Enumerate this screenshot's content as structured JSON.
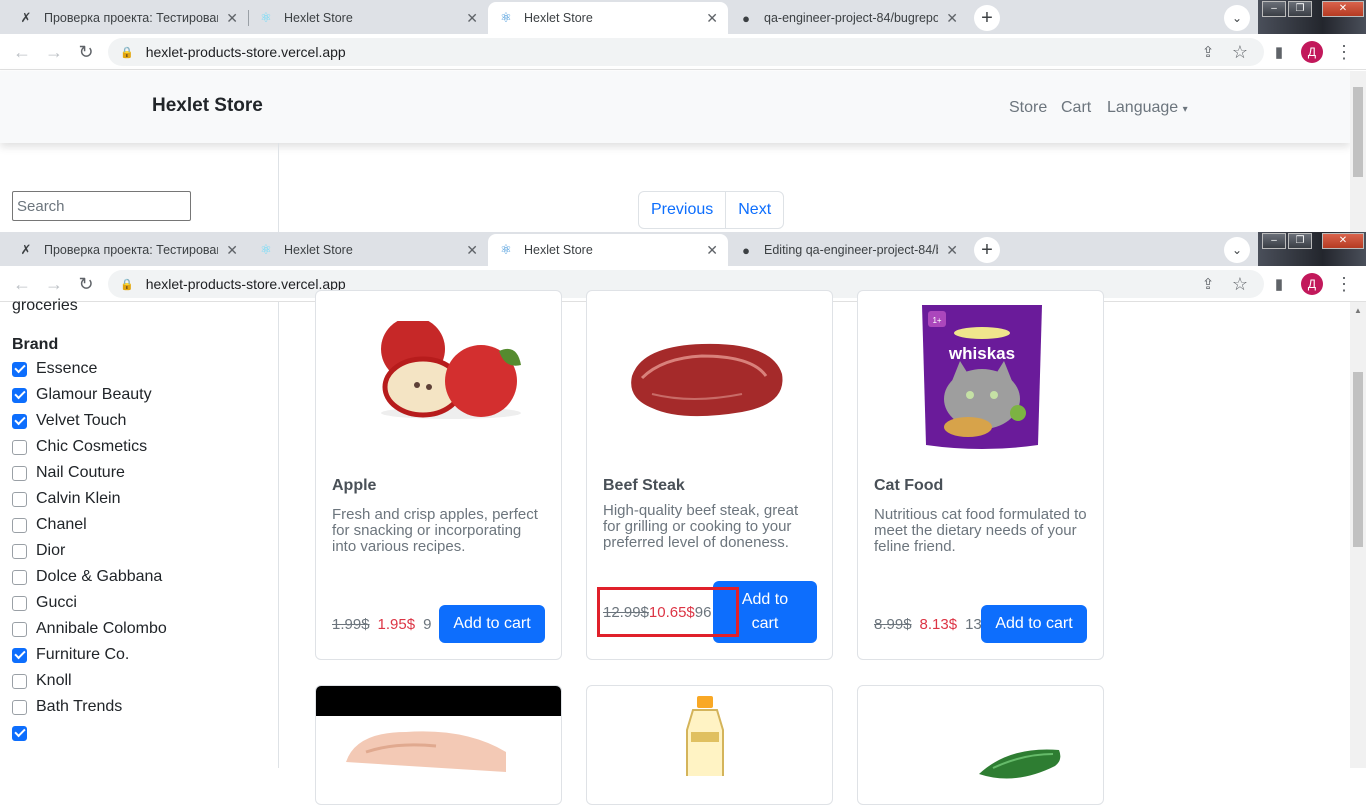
{
  "browser_top": {
    "tabs": [
      {
        "label": "Проверка проекта: Тестирован",
        "icon": "hexlet-x-icon"
      },
      {
        "label": "Hexlet Store",
        "icon": "react-icon"
      },
      {
        "label": "Hexlet Store",
        "icon": "react-icon"
      },
      {
        "label": "qa-engineer-project-84/bugrepo",
        "icon": "github-icon"
      }
    ],
    "url": "hexlet-products-store.vercel.app"
  },
  "browser_bottom": {
    "tabs": [
      {
        "label": "Проверка проекта: Тестирован",
        "icon": "hexlet-x-icon"
      },
      {
        "label": "Hexlet Store",
        "icon": "react-icon"
      },
      {
        "label": "Hexlet Store",
        "icon": "react-icon"
      },
      {
        "label": "Editing qa-engineer-project-84/b",
        "icon": "github-icon"
      }
    ],
    "url": "hexlet-products-store.vercel.app"
  },
  "avatar_letter": "Д",
  "navbar": {
    "brand": "Hexlet Store",
    "links": [
      "Store",
      "Cart",
      "Language"
    ]
  },
  "search": {
    "placeholder": "Search"
  },
  "pagination": {
    "previous": "Previous",
    "next": "Next"
  },
  "filters": {
    "category_cut": "groceries",
    "brand_heading": "Brand",
    "brands": [
      {
        "label": "Essence",
        "checked": true
      },
      {
        "label": "Glamour Beauty",
        "checked": true
      },
      {
        "label": "Velvet Touch",
        "checked": true
      },
      {
        "label": "Chic Cosmetics",
        "checked": false
      },
      {
        "label": "Nail Couture",
        "checked": false
      },
      {
        "label": "Calvin Klein",
        "checked": false
      },
      {
        "label": "Chanel",
        "checked": false
      },
      {
        "label": "Dior",
        "checked": false
      },
      {
        "label": "Dolce & Gabbana",
        "checked": false
      },
      {
        "label": "Gucci",
        "checked": false
      },
      {
        "label": "Annibale Colombo",
        "checked": false
      },
      {
        "label": "Furniture Co.",
        "checked": true
      },
      {
        "label": "Knoll",
        "checked": false
      },
      {
        "label": "Bath Trends",
        "checked": false
      },
      {
        "label": "",
        "checked": true
      }
    ]
  },
  "products": [
    {
      "title": "Apple",
      "desc": "Fresh and crisp apples, perfect for snacking or incorporating into various recipes.",
      "old_price": "1.99$",
      "new_price": "1.95$",
      "stock": "9",
      "button": "Add to cart"
    },
    {
      "title": "Beef Steak",
      "desc": "High-quality beef steak, great for grilling or cooking to your preferred level of doneness.",
      "old_price": "12.99$",
      "new_price": "10.65$",
      "stock": "96",
      "button": "Add to cart"
    },
    {
      "title": "Cat Food",
      "desc": "Nutritious cat food formulated to meet the dietary needs of your feline friend.",
      "old_price": "8.99$",
      "new_price": "8.13$",
      "stock": "13",
      "button": "Add to cart"
    }
  ],
  "colors": {
    "primary": "#0d6efd",
    "sale": "#dc3545",
    "highlight_box": "#e0202a"
  }
}
